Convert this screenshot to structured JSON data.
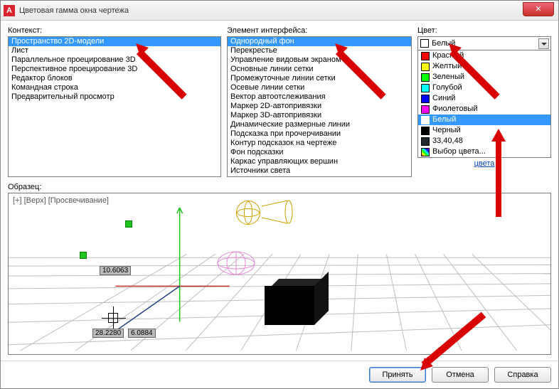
{
  "window": {
    "title": "Цветовая гамма окна чертежа"
  },
  "labels": {
    "context": "Контекст:",
    "element": "Элемент интерфейса:",
    "color": "Цвет:",
    "sample": "Образец:",
    "colors_link": "цвета"
  },
  "context": {
    "items": [
      "Пространство 2D-модели",
      "Лист",
      "Параллельное проецирование 3D",
      "Перспективное проецирование 3D",
      "Редактор блоков",
      "Командная строка",
      "Предварительный просмотр"
    ],
    "selected": 0
  },
  "element": {
    "items": [
      "Однородный фон",
      "Перекрестье",
      "Управление видовым экраном",
      "Основные линии сетки",
      "Промежуточные линии сетки",
      "Осевые линии сетки",
      "Вектор автоотслеживания",
      "Маркер 2D-автопривязки",
      "Маркер 3D-автопривязки",
      "Динамические размерные линии",
      "Подсказка при прочерчивании",
      "Контур подсказок на чертеже",
      "Фон подсказки",
      "Каркас управляющих вершин",
      "Источники света"
    ],
    "selected": 0
  },
  "color": {
    "current": "Белый",
    "options": [
      {
        "name": "Красный",
        "hex": "#ff0000"
      },
      {
        "name": "Желтый",
        "hex": "#ffff00"
      },
      {
        "name": "Зеленый",
        "hex": "#00ff00"
      },
      {
        "name": "Голубой",
        "hex": "#00ffff"
      },
      {
        "name": "Синий",
        "hex": "#0000ff"
      },
      {
        "name": "Фиолетовый",
        "hex": "#ff00ff"
      },
      {
        "name": "Белый",
        "hex": "#ffffff"
      },
      {
        "name": "Черный",
        "hex": "#000000"
      },
      {
        "name": "33,40,48",
        "hex": "#212830"
      },
      {
        "name": "Выбор цвета...",
        "hex": "pattern"
      }
    ],
    "selected": 6
  },
  "preview": {
    "overlay": "[+] [Верх] [Просвечивание]",
    "coord1": "10.6063",
    "coord2": "28.2280",
    "coord3": "6.0884"
  },
  "buttons": {
    "apply": "Принять",
    "cancel": "Отмена",
    "help": "Справка"
  }
}
